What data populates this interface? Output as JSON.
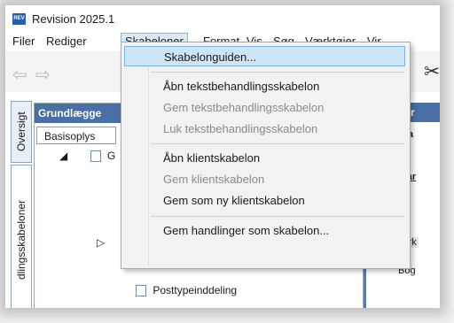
{
  "window": {
    "title": "Revision 2025.1",
    "app_icon_text": "REV"
  },
  "menubar": {
    "items": [
      {
        "label": "Filer"
      },
      {
        "label": "Rediger"
      },
      {
        "label": "Skabeloner",
        "active": true
      },
      {
        "label": "Format"
      },
      {
        "label": "Vis"
      },
      {
        "label": "Søg"
      },
      {
        "label": "Værktøjer"
      },
      {
        "label": "Vir"
      }
    ]
  },
  "toolbar": {
    "back_icon": "arrow-left-icon",
    "forward_icon": "arrow-right-icon",
    "cut_icon": "scissors-icon"
  },
  "side_tabs": {
    "overview": "Oversigt",
    "templates": "dlingsskabeloner"
  },
  "left_panel": {
    "header": "Grundlægge",
    "tool_label": "Basisoplys",
    "tree": {
      "node_letter": "G",
      "bottom_item": "Posttypeinddeling"
    }
  },
  "right_panel": {
    "header": "ner",
    "row1": "rt a",
    "row2": "star",
    "row3": "Virk",
    "row4": "jer",
    "row5": "Bog"
  },
  "dropdown": {
    "items": [
      {
        "label": "Skabelonguiden...",
        "enabled": true,
        "highlighted": true
      },
      {
        "label": "Åbn tekstbehandlingsskabelon",
        "enabled": true
      },
      {
        "label": "Gem tekstbehandlingsskabelon",
        "enabled": false
      },
      {
        "label": "Luk tekstbehandlingsskabelon",
        "enabled": false
      },
      {
        "label": "Åbn klientskabelon",
        "enabled": true
      },
      {
        "label": "Gem klientskabelon",
        "enabled": false
      },
      {
        "label": "Gem som ny klientskabelon",
        "enabled": true
      },
      {
        "label": "Gem handlinger som skabelon...",
        "enabled": true
      }
    ]
  },
  "colors": {
    "accent": "#4a6fa5",
    "highlight": "#cde5f7",
    "disabled_text": "#8a8a8a"
  }
}
